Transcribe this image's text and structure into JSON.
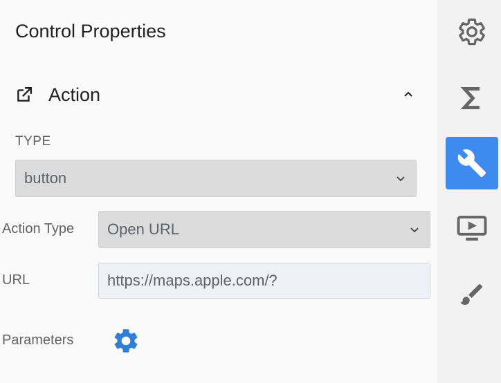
{
  "panel": {
    "title": "Control Properties",
    "section": {
      "icon": "open-in-new-icon",
      "title": "Action",
      "expanded": true
    },
    "type": {
      "label": "TYPE",
      "value": "button"
    },
    "action_type": {
      "label": "Action Type",
      "value": "Open URL"
    },
    "url": {
      "label": "URL",
      "value": "https://maps.apple.com/?"
    },
    "parameters": {
      "label": "Parameters",
      "icon": "gear-icon"
    }
  },
  "rail": {
    "items": [
      {
        "icon": "settings-icon",
        "active": false
      },
      {
        "icon": "sigma-icon",
        "active": false
      },
      {
        "icon": "wrench-icon",
        "active": true
      },
      {
        "icon": "preview-icon",
        "active": false
      },
      {
        "icon": "brush-icon",
        "active": false
      }
    ]
  },
  "colors": {
    "accent": "#3d8af1",
    "select_bg": "#dcdcdc",
    "input_bg": "#eef1f5"
  }
}
